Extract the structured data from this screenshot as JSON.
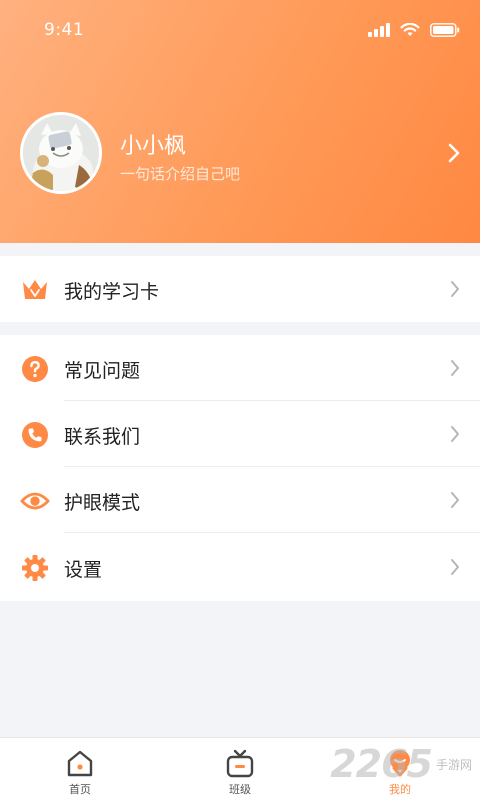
{
  "status_bar": {
    "time": "9:41"
  },
  "profile": {
    "name": "小小枫",
    "bio": "一句话介绍自己吧",
    "avatar_icon": "cat-avatar-icon"
  },
  "study_card": {
    "label": "我的学习卡",
    "icon": "crown-icon"
  },
  "menu": {
    "items": [
      {
        "label": "常见问题",
        "icon": "question-icon"
      },
      {
        "label": "联系我们",
        "icon": "phone-icon"
      },
      {
        "label": "护眼模式",
        "icon": "eye-icon"
      },
      {
        "label": "设置",
        "icon": "gear-icon"
      }
    ]
  },
  "tabbar": {
    "tabs": [
      {
        "label": "首页",
        "icon": "home-icon"
      },
      {
        "label": "班级",
        "icon": "tv-icon"
      },
      {
        "label": "我的",
        "icon": "profile-icon",
        "active": true
      }
    ]
  },
  "watermark": {
    "number": "2265",
    "text": "手游网"
  },
  "colors": {
    "accent": "#ff8a45",
    "header_start": "#ffb17f",
    "header_end": "#ff8841",
    "background": "#f2f4f7"
  }
}
